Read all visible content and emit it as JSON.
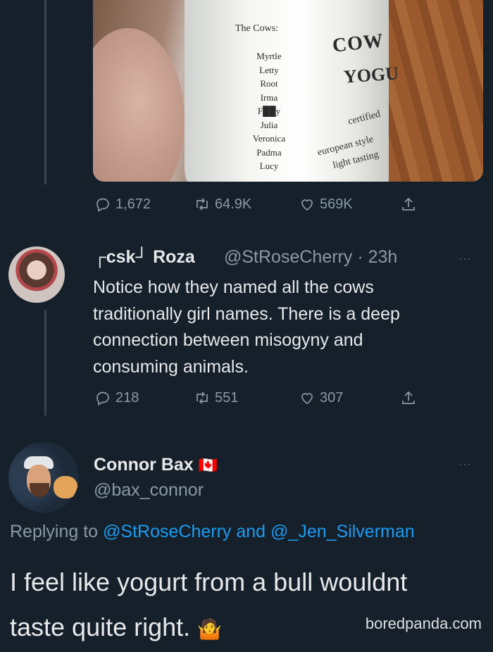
{
  "tweet1": {
    "image": {
      "title": "The Cows:",
      "names": [
        "Myrtle",
        "Letty",
        "Root",
        "Irma",
        "F██y",
        "Julia",
        "Veronica",
        "Padma",
        "Lucy"
      ],
      "brand_line1": "COW",
      "brand_line2": "YOGU",
      "tag1": "certified",
      "tag2": "european style",
      "tag3": "light tasting"
    },
    "stats": {
      "replies": "1,672",
      "retweets": "64.9K",
      "likes": "569K"
    }
  },
  "tweet2": {
    "name": "┌csk┘ Roza",
    "handle": "@StRoseCherry · 23h",
    "body_lines": [
      "Notice how they named all the cows",
      "traditionally girl names. There is a deep",
      "connection between misogyny and",
      "consuming animals."
    ],
    "stats": {
      "replies": "218",
      "retweets": "551",
      "likes": "307"
    }
  },
  "tweet3": {
    "name": "Connor Bax",
    "flag": "🇨🇦",
    "handle": "@bax_connor",
    "replying_prefix": "Replying to",
    "replying_to_1": "@StRoseCherry",
    "replying_and": "and",
    "replying_to_2": "@_Jen_Silverman",
    "body_line1": "I feel like yogurt from a bull wouldnt",
    "body_line2": "taste quite right.",
    "emoji": "🤷"
  },
  "watermark": "boredpanda.com",
  "more_glyph": "···"
}
